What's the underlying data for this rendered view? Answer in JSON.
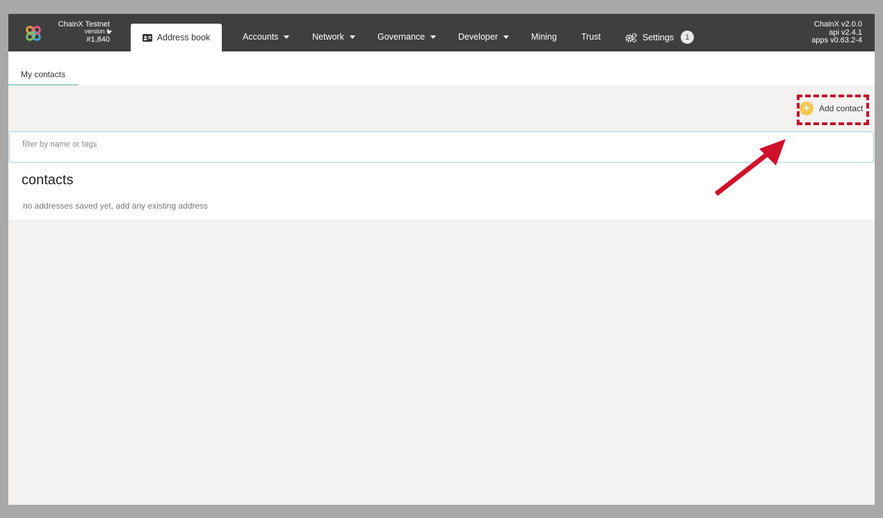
{
  "chain": {
    "name": "ChainX Testnet",
    "version": "version 1",
    "block": "#1,840"
  },
  "tabs": {
    "address_book": "Address book",
    "accounts": "Accounts",
    "network": "Network",
    "governance": "Governance",
    "developer": "Developer",
    "mining": "Mining",
    "trust": "Trust",
    "settings": "Settings",
    "settings_badge": "1"
  },
  "versions": {
    "chainx": "ChainX v2.0.0",
    "api": "api v2.4.1",
    "apps": "apps v0.63.2-4"
  },
  "subnav": {
    "my_contacts": "My contacts"
  },
  "actions": {
    "add_contact": "Add contact"
  },
  "filter": {
    "placeholder": "filter by name or tags",
    "value": ""
  },
  "contacts": {
    "title": "contacts",
    "empty": "no addresses saved yet, add any existing address"
  },
  "colors": {
    "topbar": "#3f3f3f",
    "accent_tab": "#9bd0c6",
    "plus": "#f5c856",
    "annotation": "#c0102e"
  },
  "icons": {
    "logo": "chainx-logo",
    "address_book": "address-card-icon",
    "settings": "gears-icon",
    "add": "plus-circle-icon",
    "annotation": "red-arrow"
  }
}
